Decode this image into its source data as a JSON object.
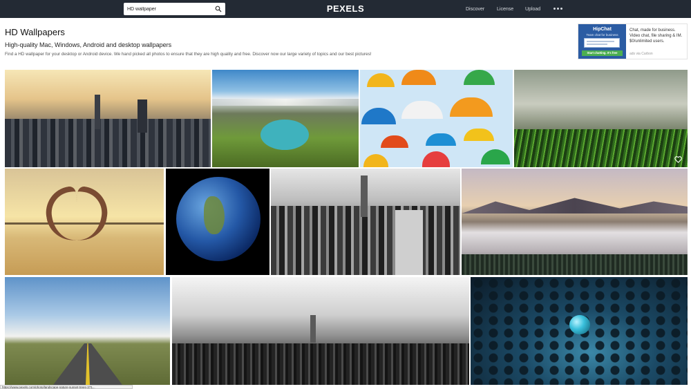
{
  "header": {
    "search": {
      "value": "HD wallpaper",
      "icon": "search-icon"
    },
    "logo": "PEXELS",
    "nav": [
      {
        "label": "Discover"
      },
      {
        "label": "License"
      },
      {
        "label": "Upload"
      }
    ],
    "more_icon": "more-dots-icon"
  },
  "page": {
    "title": "HD Wallpapers",
    "subtitle": "High-quality Mac, Windows, Android and desktop wallpapers",
    "description": "Find a HD wallpaper for your desktop or Android device. We hand picked all photos to ensure that they are high quality and free. Discover now our large variety of topics and our best pictures!"
  },
  "ad": {
    "brand": "HipChat",
    "tagline": "Team chat for business",
    "cta": "Start chatting. It's free",
    "text": "Chat, made for business. Video chat, file sharing & IM. $0/unlimited users.",
    "via": "ads via Carbon"
  },
  "photos": [
    {
      "subject": "city skyline at sunset"
    },
    {
      "subject": "mountain lake valley"
    },
    {
      "subject": "colorful umbrellas in sky"
    },
    {
      "subject": "grass close-up at dawn"
    },
    {
      "subject": "heart silhouette on beach"
    },
    {
      "subject": "planet earth"
    },
    {
      "subject": "black and white manhattan"
    },
    {
      "subject": "foggy mountain landscape"
    },
    {
      "subject": "straight road under sky"
    },
    {
      "subject": "aerial city in fog"
    },
    {
      "subject": "blue glass marbles"
    }
  ],
  "colors": {
    "topbar": "#232a34",
    "ad_brand": "#2b5ca3",
    "ad_cta": "#4caf50"
  },
  "status_url": "https://www.pexels.com/photo/landscape-nature-sunset-trees-371..."
}
